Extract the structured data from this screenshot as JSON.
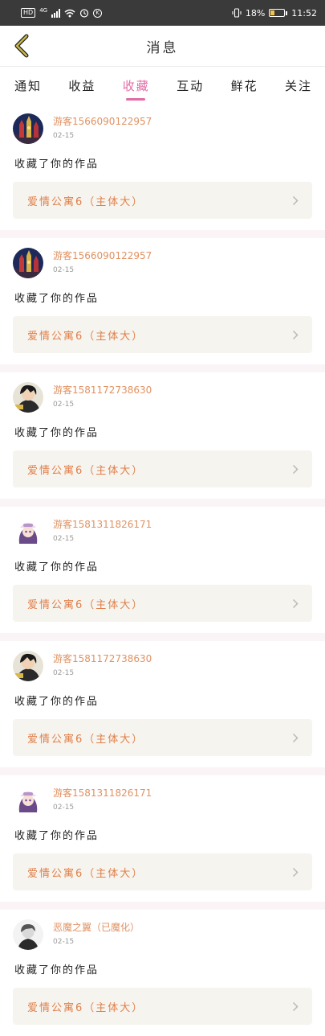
{
  "status_bar": {
    "hd": "HD",
    "net": "4G",
    "battery_pct": "18%",
    "time": "11:52",
    "k_icon": "K"
  },
  "nav": {
    "title": "消息"
  },
  "tabs": [
    {
      "label": "通知",
      "active": false
    },
    {
      "label": "收益",
      "active": false
    },
    {
      "label": "收藏",
      "active": true
    },
    {
      "label": "互动",
      "active": false
    },
    {
      "label": "鲜花",
      "active": false
    },
    {
      "label": "关注",
      "active": false
    }
  ],
  "items": [
    {
      "user": "游客1566090122957",
      "date": "02-15",
      "message": "收藏了你的作品",
      "work": "爱情公寓6（主体大）",
      "avatar": "night-castle"
    },
    {
      "user": "游客1566090122957",
      "date": "02-15",
      "message": "收藏了你的作品",
      "work": "爱情公寓6（主体大）",
      "avatar": "night-castle"
    },
    {
      "user": "游客1581172738630",
      "date": "02-15",
      "message": "收藏了你的作品",
      "work": "爱情公寓6（主体大）",
      "avatar": "anime-dark"
    },
    {
      "user": "游客1581311826171",
      "date": "02-15",
      "message": "收藏了你的作品",
      "work": "爱情公寓6（主体大）",
      "avatar": "anime-girl"
    },
    {
      "user": "游客1581172738630",
      "date": "02-15",
      "message": "收藏了你的作品",
      "work": "爱情公寓6（主体大）",
      "avatar": "anime-dark"
    },
    {
      "user": "游客1581311826171",
      "date": "02-15",
      "message": "收藏了你的作品",
      "work": "爱情公寓6（主体大）",
      "avatar": "anime-girl"
    },
    {
      "user": "恶魔之翼（已魔化）",
      "date": "02-15",
      "message": "收藏了你的作品",
      "work": "爱情公寓6（主体大）",
      "avatar": "grey-portrait"
    }
  ],
  "colors": {
    "accent": "#e46aa4",
    "username": "#e09262",
    "work_title": "#e0804a",
    "work_bg": "#f6f4ef",
    "separator": "#fbf4f6",
    "back_arrow": "#c9b54a"
  }
}
